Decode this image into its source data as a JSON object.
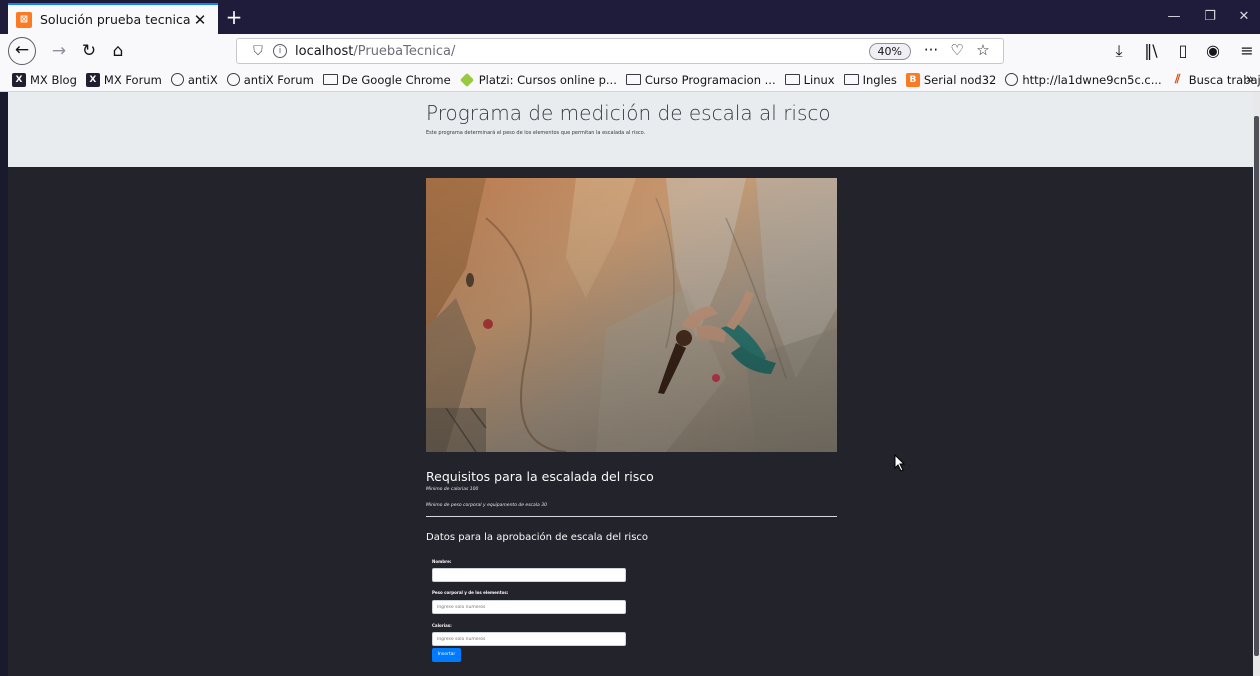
{
  "browser": {
    "tab": {
      "title": "Solución prueba tecnica",
      "favicon": "xampp-icon"
    },
    "url": {
      "host": "localhost",
      "path": "/PruebaTecnica/"
    },
    "zoom": "40%",
    "bookmarks": [
      {
        "label": "MX Blog",
        "icon": "mx-icon"
      },
      {
        "label": "MX Forum",
        "icon": "mx-icon"
      },
      {
        "label": "antiX",
        "icon": "globe-icon"
      },
      {
        "label": "antiX Forum",
        "icon": "globe-icon"
      },
      {
        "label": "De Google Chrome",
        "icon": "folder-icon"
      },
      {
        "label": "Platzi: Cursos online p...",
        "icon": "platzi-icon"
      },
      {
        "label": "Curso Programacion ...",
        "icon": "folder-icon"
      },
      {
        "label": "Linux",
        "icon": "folder-icon"
      },
      {
        "label": "Ingles",
        "icon": "folder-icon"
      },
      {
        "label": "Serial nod32",
        "icon": "blogger-icon"
      },
      {
        "label": "http://la1dwne9cn5c.c...",
        "icon": "globe-icon"
      },
      {
        "label": "Busca trabajos IT - ticj...",
        "icon": "stack-icon"
      }
    ]
  },
  "page": {
    "header": {
      "title": "Programa de medición de escala al risco",
      "lead": "Este programa determinará el peso de los elementos que permitan la escalada al risco."
    },
    "requirements": {
      "title": "Requisitos para la escalada del risco",
      "item1": "Minimo de calorias 100",
      "item2": "Minimo de peso corporal y equipamento de escala 30"
    },
    "form": {
      "title": "Datos para la aprobación de escala del risco",
      "name_label": "Nombre:",
      "name_placeholder": "",
      "weight_label": "Peso corporal y de los elementos:",
      "weight_placeholder": "Ingrese solo numeros",
      "calories_label": "Calorias:",
      "calories_placeholder": "Ingrese solo numeros",
      "submit_label": "Insertar"
    }
  },
  "colors": {
    "page_bg": "#23232b",
    "jumbotron_bg": "#e9ecef",
    "primary": "#007bff",
    "titlebar": "#1f1b3a"
  }
}
